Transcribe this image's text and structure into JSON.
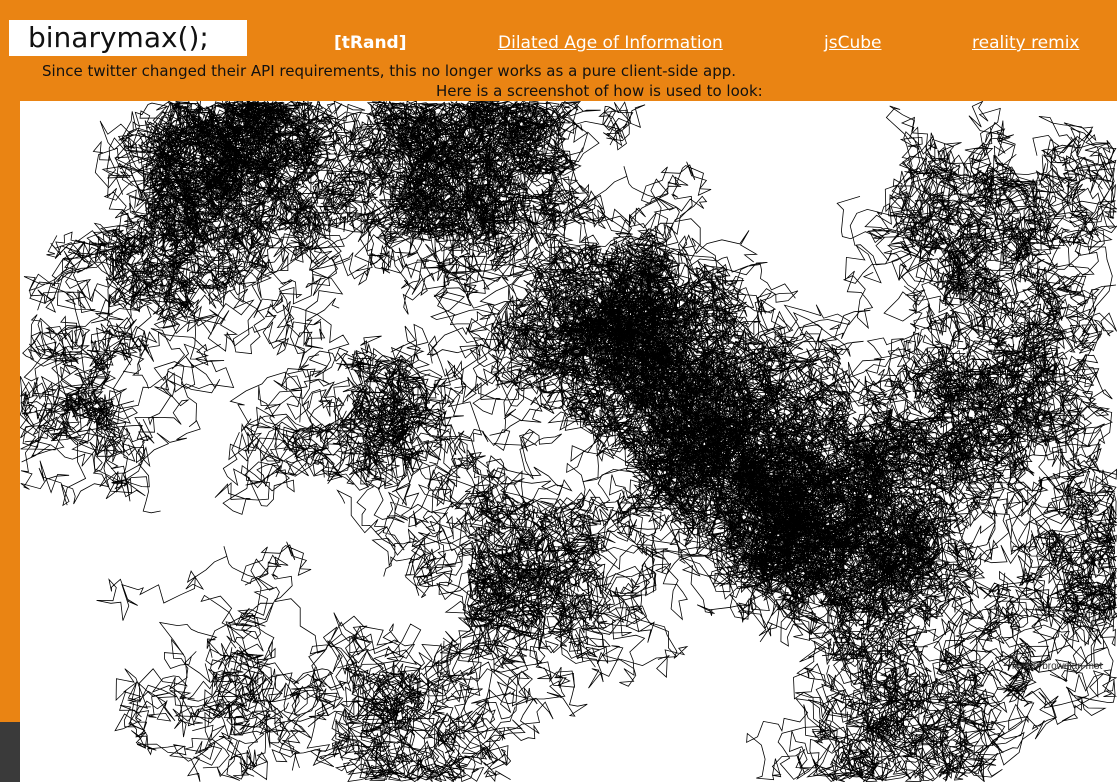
{
  "site": {
    "logo": "binarymax();"
  },
  "nav": {
    "current": "[tRand]",
    "links": [
      "Dilated Age of Information",
      "jsCube ",
      "reality remix"
    ]
  },
  "notice": {
    "line1": "Since twitter changed their API requirements, this no longer works as a pure client-side app.",
    "line2": "Here is a screenshot of how is used to look:"
  },
  "screenshot": {
    "caption": "Twitter brownian mot",
    "line_color": "#000000",
    "background": "#ffffff"
  },
  "colors": {
    "brand_orange": "#ea8413",
    "text_dark": "#111111",
    "link_white": "#ffffff"
  }
}
